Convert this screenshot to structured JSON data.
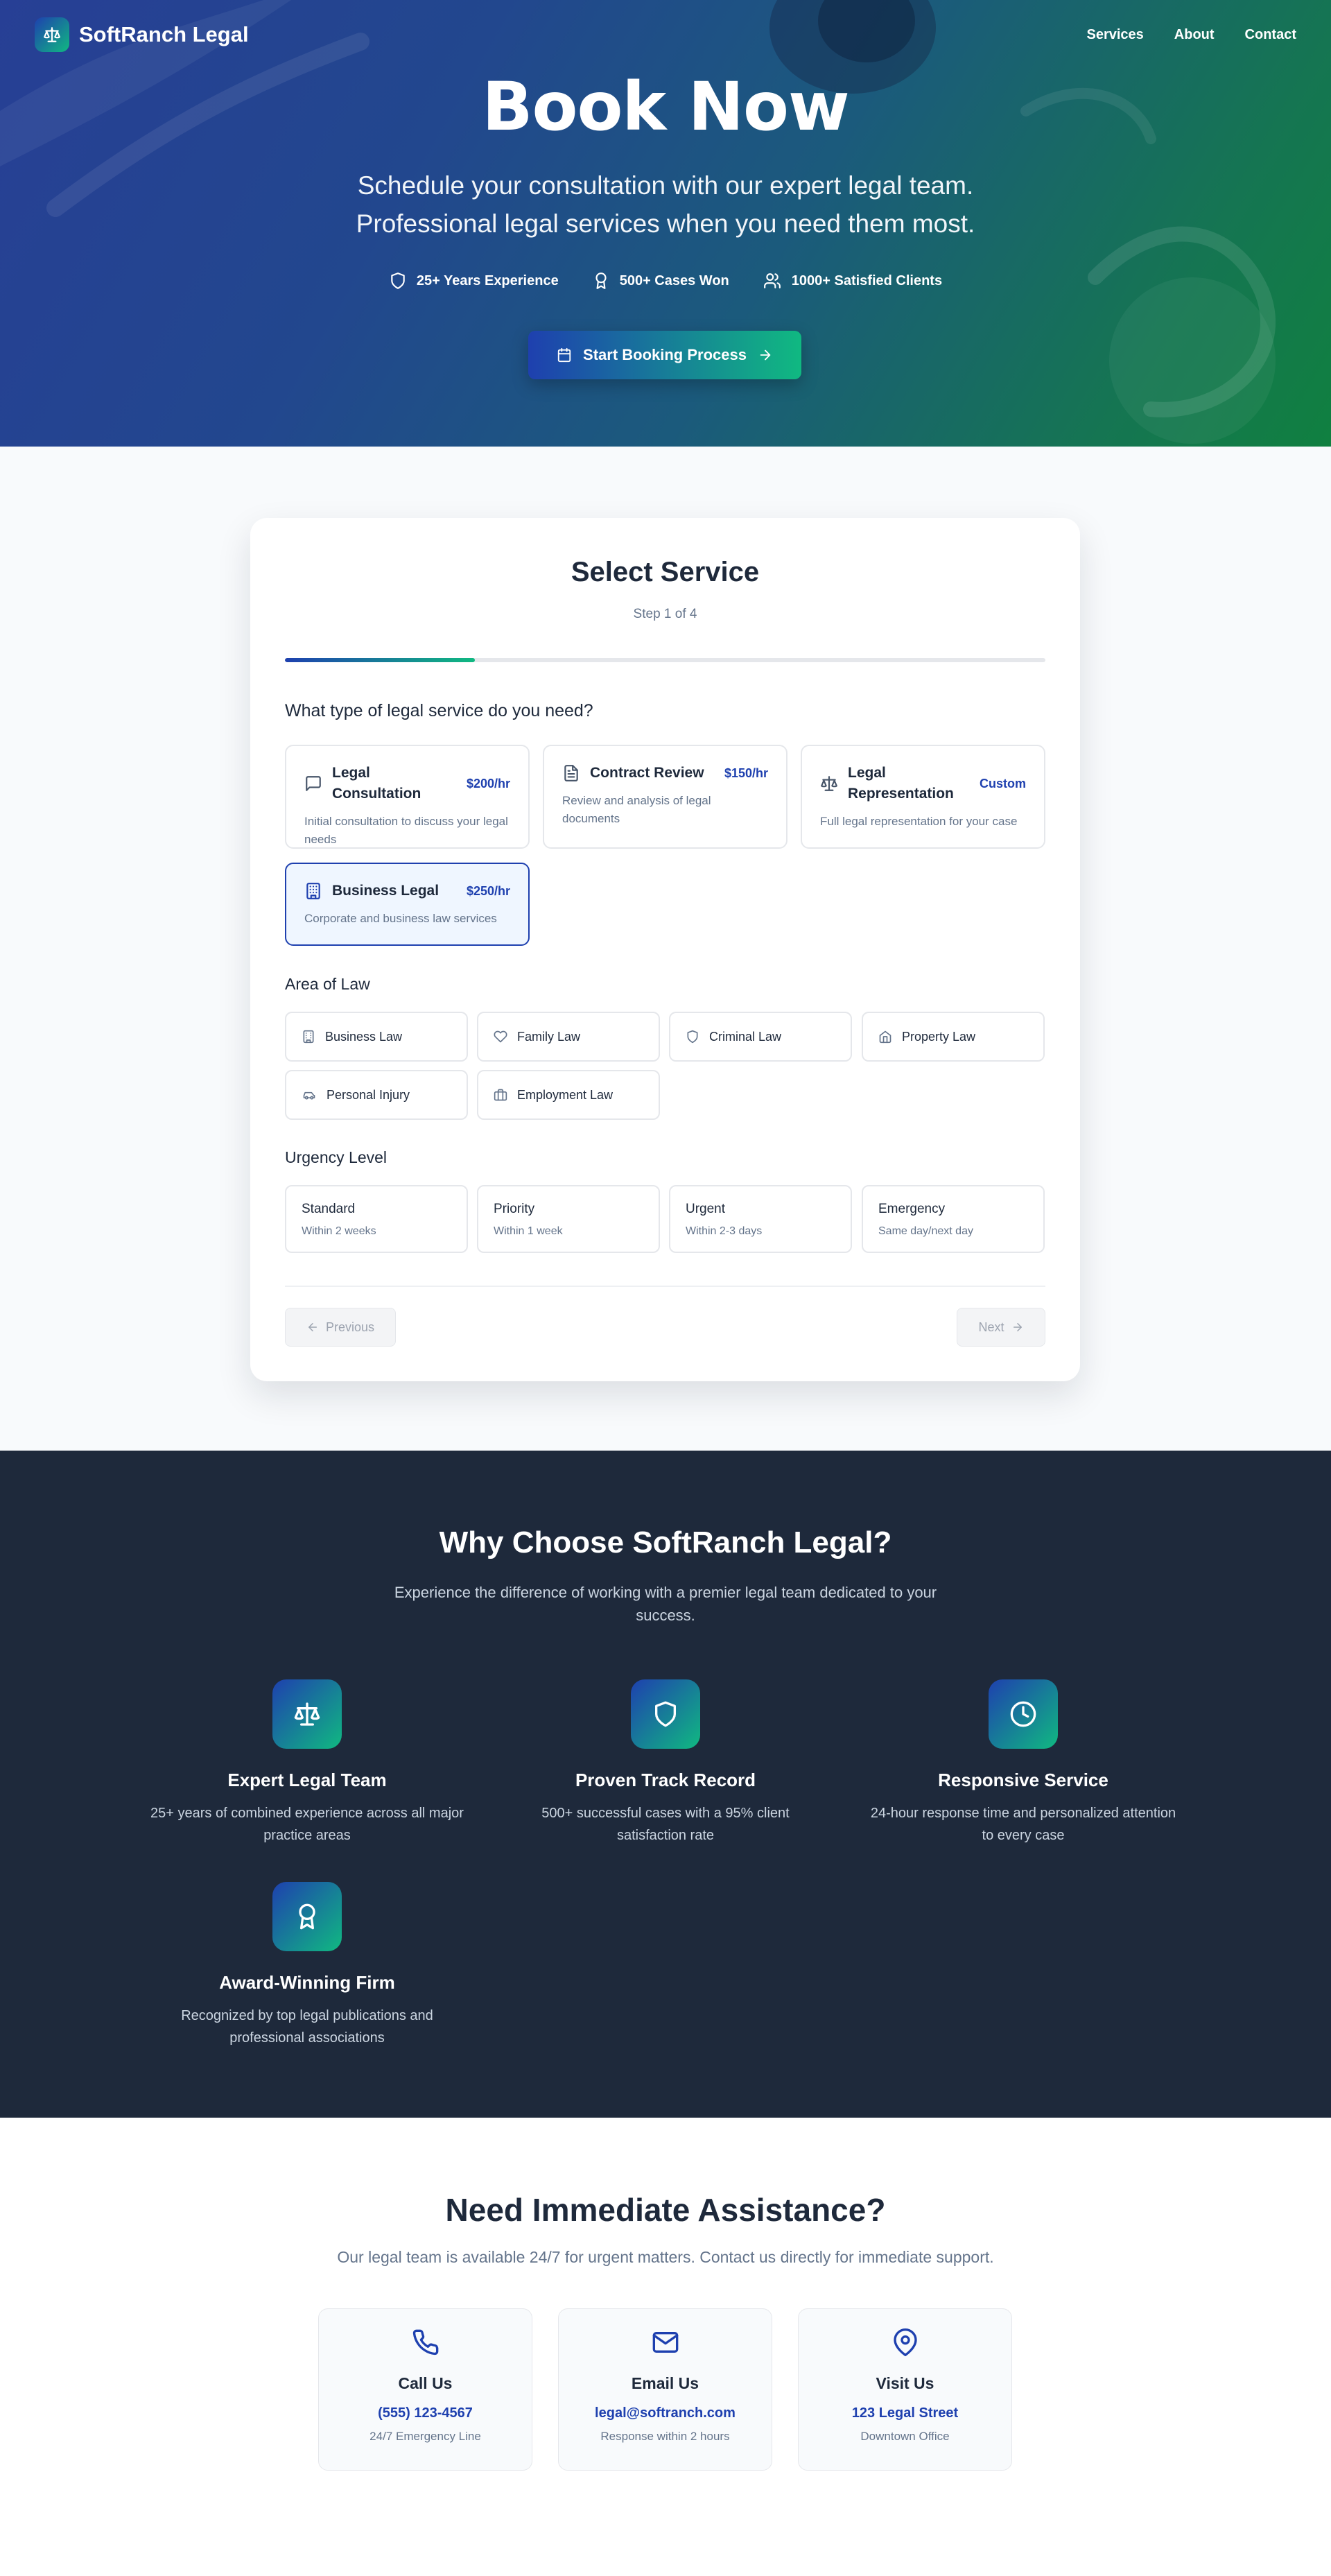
{
  "brand": {
    "name": "SoftRanch Legal",
    "logo_icon": "scale-icon"
  },
  "nav": {
    "links": [
      "Services",
      "About",
      "Contact"
    ]
  },
  "hero": {
    "title": "Book Now",
    "subtitle_line1": "Schedule your consultation with our expert legal team.",
    "subtitle_line2": "Professional legal services when you need them most.",
    "stats": [
      {
        "icon": "shield-icon",
        "label": "25+ Years Experience"
      },
      {
        "icon": "award-icon",
        "label": "500+ Cases Won"
      },
      {
        "icon": "users-icon",
        "label": "1000+ Satisfied Clients"
      }
    ],
    "cta_label": "Start Booking Process"
  },
  "booking": {
    "title": "Select Service",
    "step": "Step 1 of 4",
    "progress": 0.25,
    "question": "What type of legal service do you need?",
    "services": [
      {
        "icon": "message-icon",
        "name": "Legal Consultation",
        "price": "$200/hr",
        "desc": "Initial consultation to discuss your legal needs",
        "selected": false
      },
      {
        "icon": "document-icon",
        "name": "Contract Review",
        "price": "$150/hr",
        "desc": "Review and analysis of legal documents",
        "selected": false
      },
      {
        "icon": "scale-icon",
        "name": "Legal Representation",
        "price": "Custom",
        "desc": "Full legal representation for your case",
        "selected": false
      },
      {
        "icon": "building-icon",
        "name": "Business Legal",
        "price": "$250/hr",
        "desc": "Corporate and business law services",
        "selected": true
      }
    ],
    "area_label": "Area of Law",
    "areas": [
      {
        "icon": "building-icon",
        "label": "Business Law"
      },
      {
        "icon": "heart-icon",
        "label": "Family Law"
      },
      {
        "icon": "shield-icon",
        "label": "Criminal Law"
      },
      {
        "icon": "home-icon",
        "label": "Property Law"
      },
      {
        "icon": "car-icon",
        "label": "Personal Injury"
      },
      {
        "icon": "briefcase-icon",
        "label": "Employment Law"
      }
    ],
    "urgency_label": "Urgency Level",
    "urgency": [
      {
        "title": "Standard",
        "sub": "Within 2 weeks"
      },
      {
        "title": "Priority",
        "sub": "Within 1 week"
      },
      {
        "title": "Urgent",
        "sub": "Within 2-3 days"
      },
      {
        "title": "Emergency",
        "sub": "Same day/next day"
      }
    ],
    "prev_label": "Previous",
    "next_label": "Next"
  },
  "why": {
    "title": "Why Choose SoftRanch Legal?",
    "lead": "Experience the difference of working with a premier legal team dedicated to your success.",
    "features": [
      {
        "icon": "scale-icon",
        "title": "Expert Legal Team",
        "desc": "25+ years of combined experience across all major practice areas"
      },
      {
        "icon": "shield-icon",
        "title": "Proven Track Record",
        "desc": "500+ successful cases with a 95% client satisfaction rate"
      },
      {
        "icon": "clock-icon",
        "title": "Responsive Service",
        "desc": "24-hour response time and personalized attention to every case"
      },
      {
        "icon": "award-icon",
        "title": "Award-Winning Firm",
        "desc": "Recognized by top legal publications and professional associations"
      }
    ]
  },
  "contact": {
    "title": "Need Immediate Assistance?",
    "lead": "Our legal team is available 24/7 for urgent matters. Contact us directly for immediate support.",
    "cards": [
      {
        "icon": "phone-icon",
        "title": "Call Us",
        "value": "(555) 123-4567",
        "sub": "24/7 Emergency Line"
      },
      {
        "icon": "mail-icon",
        "title": "Email Us",
        "value": "legal@softranch.com",
        "sub": "Response within 2 hours"
      },
      {
        "icon": "pin-icon",
        "title": "Visit Us",
        "value": "123 Legal Street",
        "sub": "Downtown Office"
      }
    ]
  },
  "colors": {
    "primary": "#1e40af",
    "accent": "#10b981",
    "dark": "#1e293b"
  }
}
